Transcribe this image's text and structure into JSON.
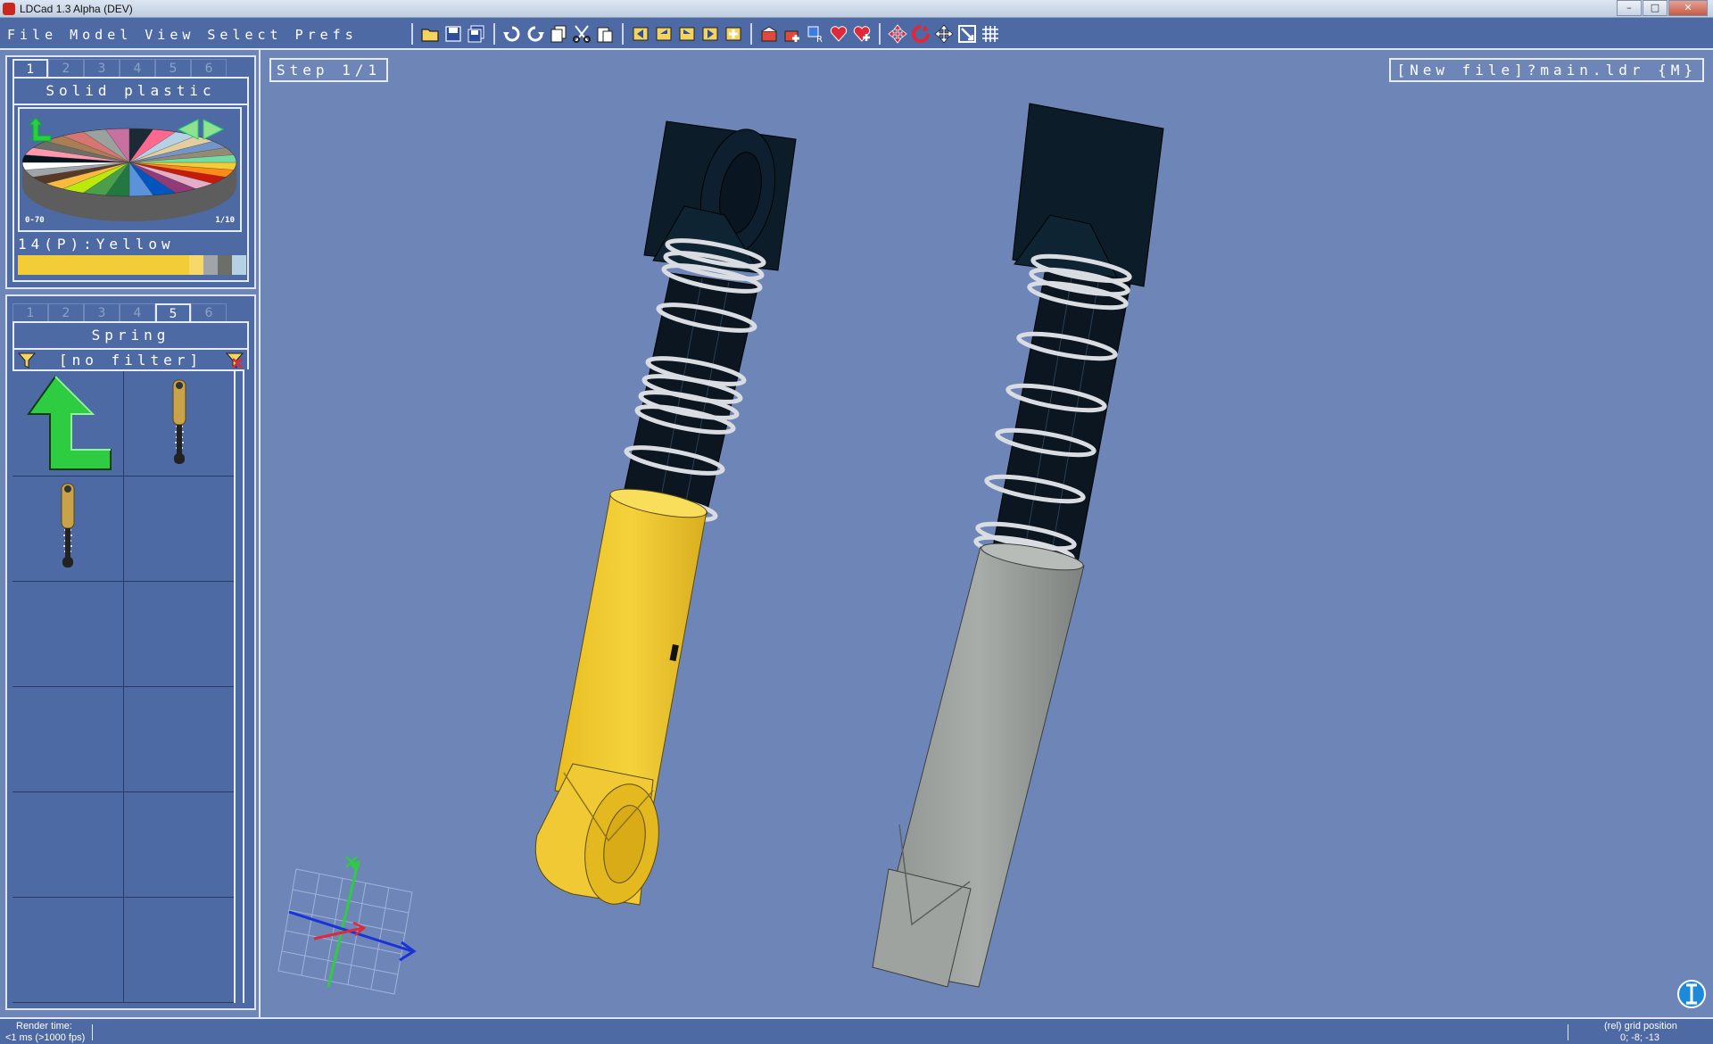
{
  "window": {
    "title": "LDCad 1.3 Alpha (DEV)",
    "min": "–",
    "max": "□",
    "close": "✕"
  },
  "menu": [
    "File",
    "Model",
    "View",
    "Select",
    "Prefs"
  ],
  "toolbar_icons": [
    "open-icon",
    "save-icon",
    "save-all-icon",
    "undo-icon",
    "redo-icon",
    "copy-icon",
    "cut-icon",
    "paste-icon",
    "first-step-icon",
    "prev-step-icon",
    "next-step-icon",
    "last-step-icon",
    "add-step-icon",
    "submodel-icon",
    "add-submodel-icon",
    "rotate-submodel-icon",
    "favorite-icon",
    "add-favorite-icon",
    "move-icon",
    "rotate-icon",
    "pan-icon",
    "zoom-icon",
    "grid-icon"
  ],
  "color_panel": {
    "tabs": [
      "1",
      "2",
      "3",
      "4",
      "5",
      "6"
    ],
    "active_tab": "1",
    "title": "Solid plastic",
    "range_left": "0-70",
    "range_right": "1/10",
    "selected_color": "14(P):Yellow",
    "selected_hex": "#f2cd37",
    "swatches": [
      "#f2cd37",
      "#f2cd37",
      "#f2cd37",
      "#f2cd37",
      "#f2cd37",
      "#f2cd37",
      "#f2cd37",
      "#f2cd37",
      "#f2cd37",
      "#f2cd37",
      "#f2cd37",
      "#f2cd37",
      "#f7d96a",
      "#a0a5a9",
      "#6c6e68",
      "#b4d2e3"
    ]
  },
  "parts_panel": {
    "tabs": [
      "1",
      "2",
      "3",
      "4",
      "5",
      "6"
    ],
    "active_tab": "5",
    "title": "Spring",
    "filter": "[no filter]"
  },
  "viewport": {
    "step": "Step 1/1",
    "file": "[New file]?main.ldr {M}",
    "background": "#6e85b8"
  },
  "status": {
    "render_label": "Render time:",
    "render_value": "<1 ms (>1000 fps)",
    "grid_label": "(rel) grid position",
    "grid_value": "0; -8; -13"
  }
}
